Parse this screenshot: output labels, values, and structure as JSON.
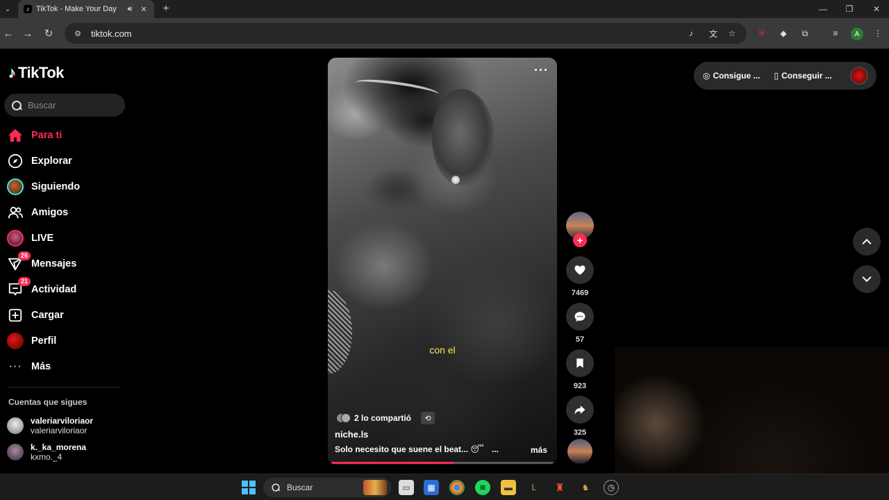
{
  "browser": {
    "tab_title": "TikTok - Make Your Day",
    "url": "tiktok.com",
    "profile_initial": "A"
  },
  "logo_text": "TikTok",
  "search": {
    "placeholder": "Buscar"
  },
  "nav": [
    {
      "label": "Para ti",
      "icon": "home-icon",
      "active": true
    },
    {
      "label": "Explorar",
      "icon": "compass-icon"
    },
    {
      "label": "Siguiendo",
      "icon": "following-avatar"
    },
    {
      "label": "Amigos",
      "icon": "friends-icon"
    },
    {
      "label": "LIVE",
      "icon": "live-avatar"
    },
    {
      "label": "Mensajes",
      "icon": "messages-icon",
      "badge": "26"
    },
    {
      "label": "Actividad",
      "icon": "activity-icon",
      "badge": "21"
    },
    {
      "label": "Cargar",
      "icon": "upload-icon"
    },
    {
      "label": "Perfil",
      "icon": "profile-avatar"
    },
    {
      "label": "Más",
      "icon": "more-icon"
    }
  ],
  "following": {
    "title": "Cuentas que sigues",
    "accounts": [
      {
        "name": "valeriarviloriaor",
        "handle": "valeriarviloriaor"
      },
      {
        "name": "k._ka_morena",
        "handle": "kxmo._4"
      }
    ]
  },
  "video": {
    "caption": "con el",
    "shared_text": "2 lo compartió",
    "author": "niche.ls",
    "description": "Solo necesito que suene el beat... 😴",
    "description_ellipsis": "...",
    "more_label": "más",
    "progress": 0.55
  },
  "actions": {
    "likes": "7469",
    "comments": "57",
    "saves": "923",
    "shares": "325"
  },
  "topright": {
    "coins_label": "Consigue ...",
    "app_label": "Conseguir ..."
  },
  "taskbar": {
    "search_label": "Buscar"
  },
  "colors": {
    "accent": "#fe2c55",
    "cyan": "#25f4ee",
    "caption_yellow": "#f6e75b"
  }
}
